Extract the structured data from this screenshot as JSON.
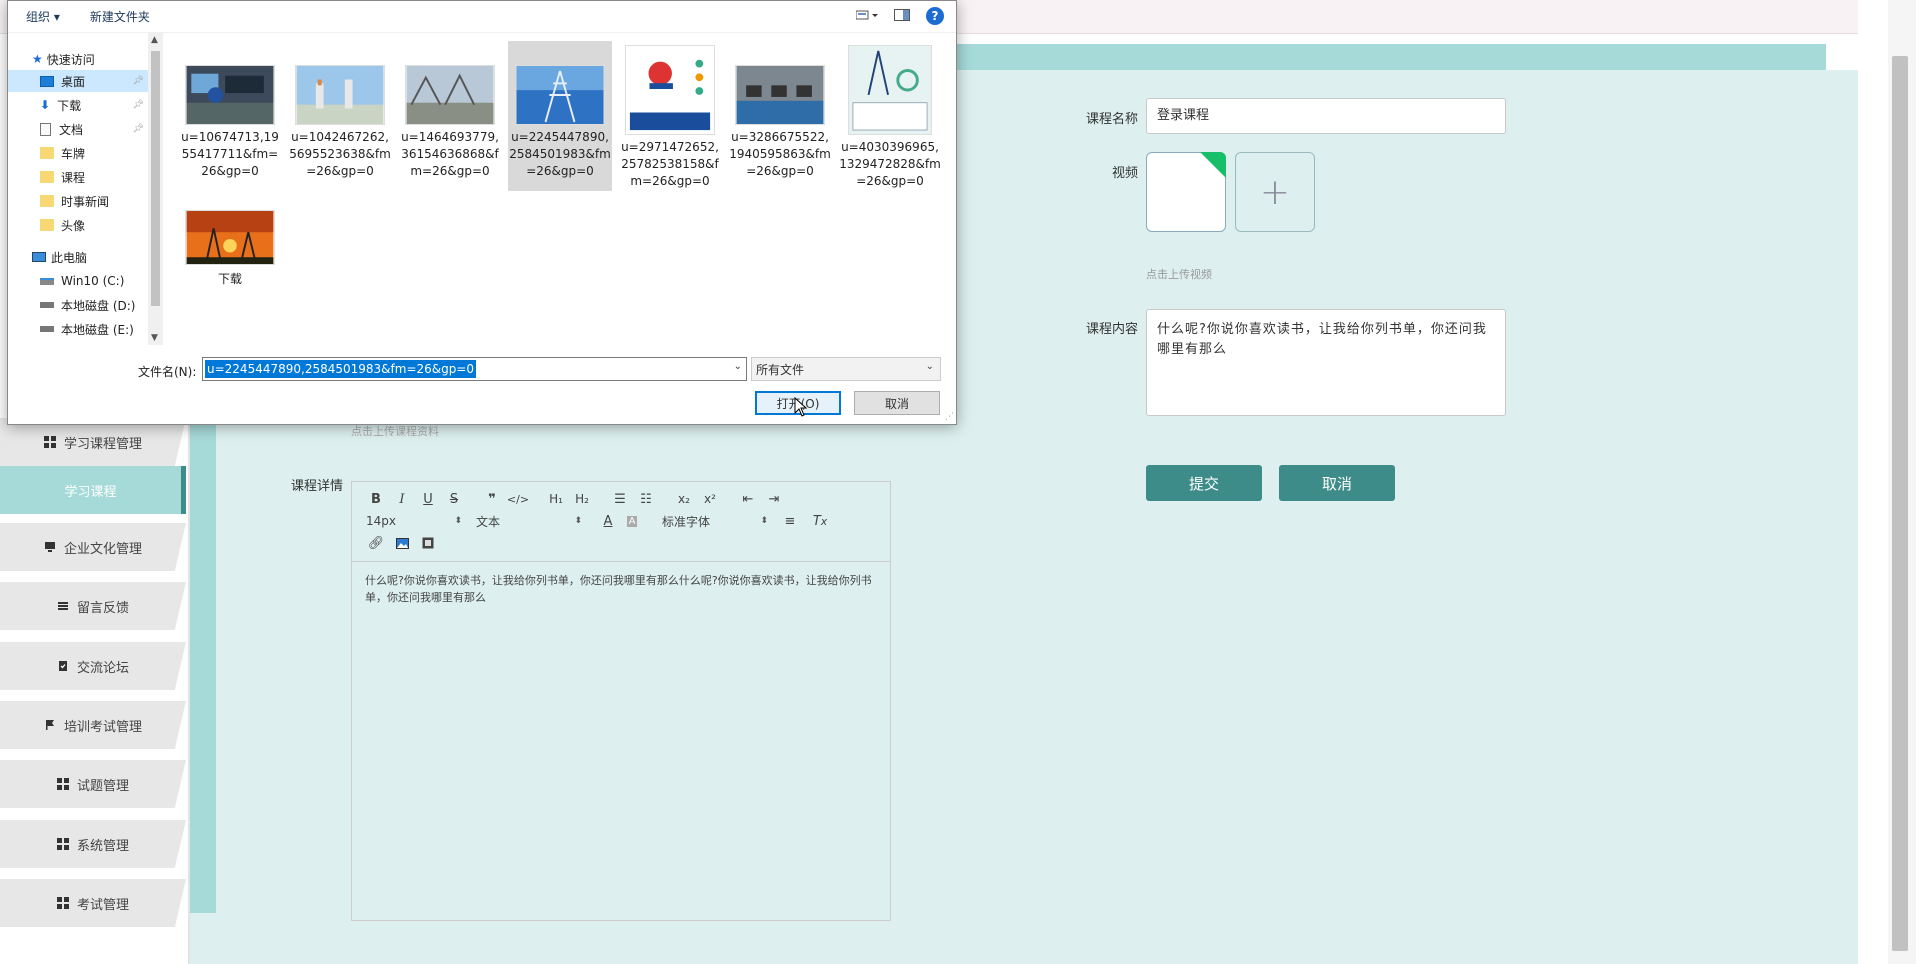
{
  "sidebar": {
    "items": [
      {
        "label": "学习课程管理",
        "icon": "grid-icon"
      },
      {
        "label": "学习课程",
        "active": true
      },
      {
        "label": "企业文化管理",
        "icon": "monitor-icon"
      },
      {
        "label": "留言反馈",
        "icon": "list-icon"
      },
      {
        "label": "交流论坛",
        "icon": "clipboard-check-icon"
      },
      {
        "label": "培训考试管理",
        "icon": "flag-icon"
      },
      {
        "label": "试题管理",
        "icon": "grid-icon"
      },
      {
        "label": "系统管理",
        "icon": "grid-icon"
      },
      {
        "label": "考试管理",
        "icon": "grid-icon"
      }
    ]
  },
  "form": {
    "course_name_label": "课程名称",
    "course_name_value": "登录课程",
    "video_label": "视频",
    "video_hint": "点击上传视频",
    "content_label": "课程内容",
    "content_value": "什么呢?你说你喜欢读书，让我给你列书单，你还问我哪里有那么",
    "material_hint": "点击上传课程资料",
    "detail_label": "课程详情",
    "submit_label": "提交",
    "cancel_label": "取消"
  },
  "editor": {
    "font_size": "14px",
    "block_type": "文本",
    "font_family": "标准字体",
    "body": "什么呢?你说你喜欢读书，让我给你列书单，你还问我哪里有那么什么呢?你说你喜欢读书，让我给你列书单，你还问我哪里有那么"
  },
  "dialog": {
    "cmd_organize": "组织 ▾",
    "cmd_new_folder": "新建文件夹",
    "nav": {
      "quick_access": "快速访问",
      "items": [
        "桌面",
        "下载",
        "文档",
        "车牌",
        "课程",
        "时事新闻",
        "头像"
      ],
      "this_pc": "此电脑",
      "drives": [
        "Win10 (C:)",
        "本地磁盘 (D:)",
        "本地磁盘 (E:)"
      ]
    },
    "files": [
      {
        "name": "u=10674713,1955417711&fm=26&gp=0"
      },
      {
        "name": "u=1042467262,5695523638&fm=26&gp=0"
      },
      {
        "name": "u=1464693779,36154636868&fm=26&gp=0"
      },
      {
        "name": "u=2245447890,2584501983&fm=26&gp=0",
        "selected": true
      },
      {
        "name": "u=2971472652,25782538158&fm=26&gp=0"
      },
      {
        "name": "u=3286675522,1940595863&fm=26&gp=0"
      },
      {
        "name": "u=4030396965,1329472828&fm=26&gp=0"
      },
      {
        "name": "下载"
      }
    ],
    "filename_label": "文件名(N):",
    "filename_value": "u=2245447890,2584501983&fm=26&gp=0",
    "filter_value": "所有文件",
    "open_label": "打开(O)",
    "cancel_label": "取消"
  },
  "colors": {
    "accent": "#3e8c8a",
    "teal_light": "#a6dad9",
    "content_bg": "#ddf0ef",
    "selection_blue": "#0078d7"
  }
}
